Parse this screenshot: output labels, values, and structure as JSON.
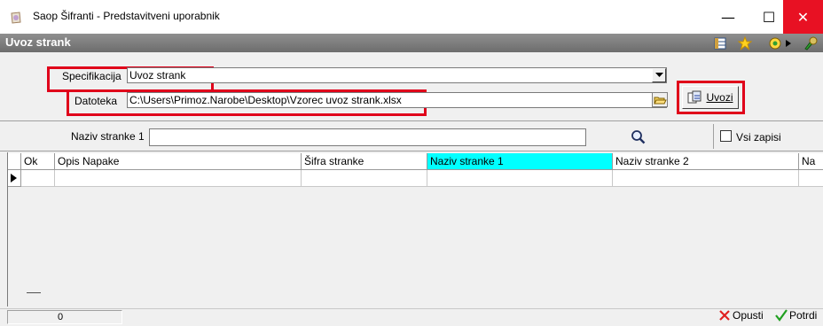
{
  "window": {
    "title": "Saop Šifranti - Predstavitveni uporabnik",
    "minimize": "—",
    "maximize": "☐",
    "close": "✕"
  },
  "header": {
    "title": "Uvoz strank"
  },
  "form": {
    "specifikacija_label": "Specifikacija",
    "specifikacija_value": "Uvoz strank",
    "datoteka_label": "Datoteka",
    "datoteka_value": "C:\\Users\\Primoz.Narobe\\Desktop\\Vzorec uvoz strank.xlsx",
    "import_button": "Uvozi"
  },
  "filter": {
    "label": "Naziv stranke 1",
    "value": "",
    "all_records_label": "Vsi zapisi",
    "all_records_checked": false
  },
  "grid": {
    "columns": [
      "Ok",
      "Opis Napake",
      "Šifra stranke",
      "Naziv stranke 1",
      "Naziv stranke 2",
      "Na"
    ],
    "highlight_column": "Naziv stranke 1",
    "highlight_color": "#00ffff"
  },
  "status": {
    "count": "0"
  },
  "footer": {
    "cancel_label": "Opusti",
    "confirm_label": "Potrdi"
  },
  "colors": {
    "annotation_red": "#e0001a",
    "close_red": "#e81123"
  }
}
